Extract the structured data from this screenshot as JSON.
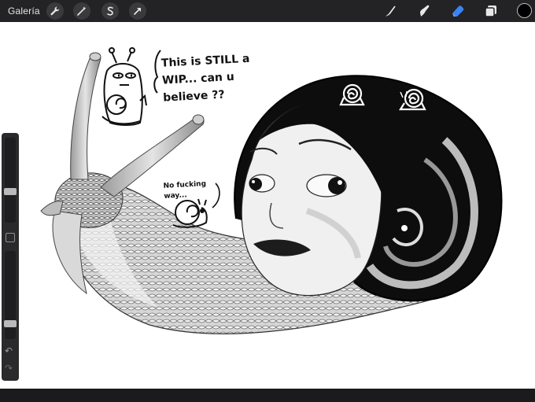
{
  "toolbar": {
    "gallery_label": "Galería",
    "left_tools": [
      {
        "icon": "wrench-icon"
      },
      {
        "icon": "magic-wand-icon"
      },
      {
        "icon": "selection-s-icon"
      },
      {
        "icon": "transform-arrow-icon"
      }
    ],
    "right_tools": [
      {
        "icon": "brush-icon"
      },
      {
        "icon": "smudge-icon"
      },
      {
        "icon": "eraser-icon"
      },
      {
        "icon": "layers-icon"
      }
    ],
    "active_color": "#000000",
    "eraser_color": "#3b82f6"
  },
  "sidebar": {
    "brush_size_level": 0.35,
    "opacity_level": 0.15
  },
  "artwork": {
    "note_1": "This is STILL a WIP... can u believe ??",
    "note_2": "No fucking way..."
  },
  "colors": {
    "chrome": "#232325",
    "canvas": "#ffffff"
  }
}
